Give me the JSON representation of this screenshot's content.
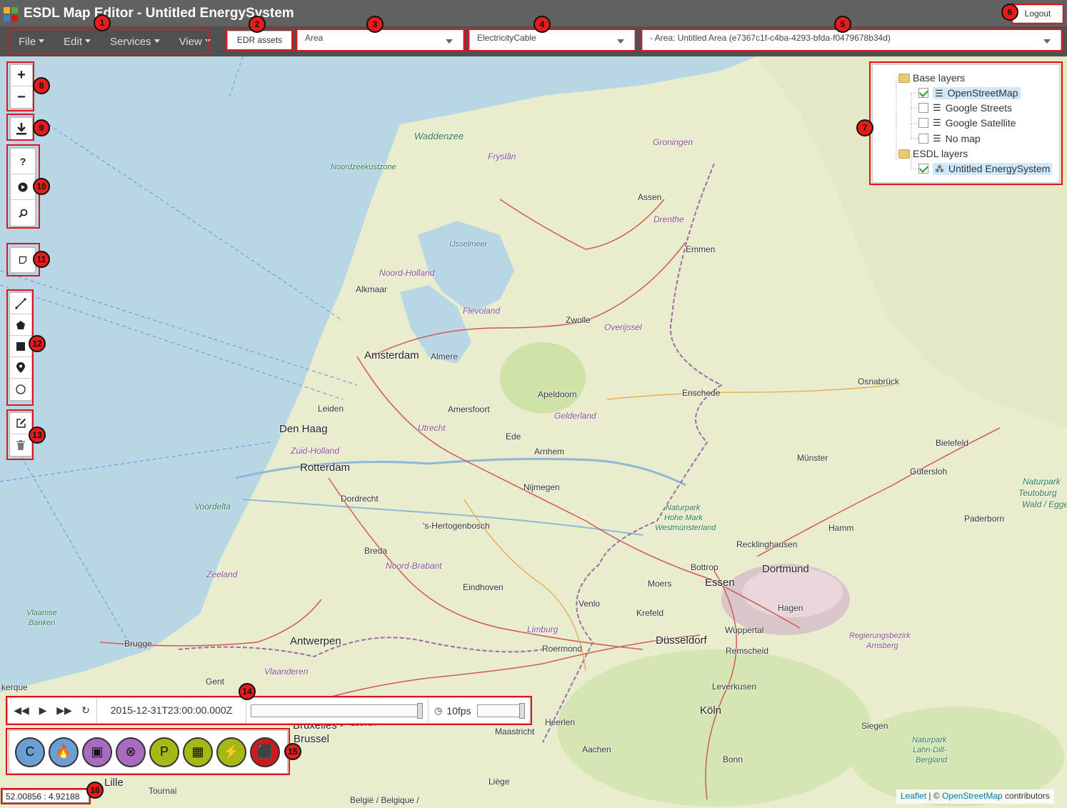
{
  "app": {
    "title": "ESDL Map Editor - Untitled EnergySystem"
  },
  "header": {
    "logout_label": "Logout"
  },
  "menubar": {
    "items": [
      {
        "label": "File"
      },
      {
        "label": "Edit"
      },
      {
        "label": "Services"
      },
      {
        "label": "View"
      }
    ]
  },
  "toolbar": {
    "edr_label": "EDR assets",
    "area_select": "Area",
    "asset_select": "ElectricityCable",
    "area_scope_select": "- Area: Untitled Area (e7367c1f-c4ba-4293-bfda-f0479678b34d)"
  },
  "layers": {
    "base_group": "Base layers",
    "base_items": [
      {
        "label": "OpenStreetMap",
        "checked": true
      },
      {
        "label": "Google Streets",
        "checked": false
      },
      {
        "label": "Google Satellite",
        "checked": false
      },
      {
        "label": "No map",
        "checked": false
      }
    ],
    "esdl_group": "ESDL layers",
    "esdl_items": [
      {
        "label": "Untitled EnergySystem",
        "checked": true
      }
    ]
  },
  "map_controls": {
    "zoom_in": "+",
    "zoom_out": "−",
    "help": "?"
  },
  "player": {
    "timestamp": "2015-12-31T23:00:00.000Z",
    "fps": "10fps"
  },
  "assets": [
    {
      "icon": "C",
      "color": "#4d8fc9",
      "name": "consumer-c"
    },
    {
      "icon": "🔥",
      "color": "#4d8fc9",
      "name": "flame"
    },
    {
      "icon": "▣",
      "color": "#9b59b6",
      "name": "storage"
    },
    {
      "icon": "⊗",
      "color": "#9b59b6",
      "name": "conversion"
    },
    {
      "icon": "P",
      "color": "#a6b814",
      "name": "producer-p"
    },
    {
      "icon": "▦",
      "color": "#a6b814",
      "name": "network"
    },
    {
      "icon": "⚡",
      "color": "#a6b814",
      "name": "plant"
    },
    {
      "icon": "⬛",
      "color": "#d0191b",
      "name": "battery"
    }
  ],
  "coords": "52.00856 : 4.92188",
  "attribution": {
    "leaflet": "Leaflet",
    "sep": " | © ",
    "osm": "OpenStreetMap",
    "tail": " contributors"
  },
  "places": {
    "waddenzee": "Waddenzee",
    "noordzeekustzone": "Noordzeekustzone",
    "fryslan": "Fryslân",
    "groningen": "Groningen",
    "assen": "Assen",
    "drenthe": "Drenthe",
    "emmen": "Emmen",
    "ijsselmeer": "IJsselmeer",
    "noordholland": "Noord-Holland",
    "alkmaar": "Alkmaar",
    "flevoland": "Flevoland",
    "zwolle": "Zwolle",
    "overijssel": "Overijssel",
    "amsterdam": "Amsterdam",
    "almere": "Almere",
    "apeldoorn": "Apeldoorn",
    "enschede": "Enschede",
    "osnabruck": "Osnabrück",
    "leiden": "Leiden",
    "amersfoort": "Amersfoort",
    "gelderland": "Gelderland",
    "denhaag": "Den Haag",
    "utrecht": "Utrecht",
    "ede": "Ede",
    "zuidholland": "Zuid-Holland",
    "arnhem": "Arnhem",
    "rotterdam": "Rotterdam",
    "munster": "Münster",
    "bielefeld": "Bielefeld",
    "gutersloh": "Gütersloh",
    "nijmegen": "Nijmegen",
    "dordrecht": "Dordrecht",
    "voordelta": "Voordelta",
    "naturpark1": "Naturpark",
    "hohemark": "Hohe Mark",
    "westmunsterland": "Westmünsterland",
    "paderborn": "Paderborn",
    "shertogenbosch": "'s-Hertogenbosch",
    "hamm": "Hamm",
    "recklinghausen": "Recklinghausen",
    "breda": "Breda",
    "bottrop": "Bottrop",
    "dortmund": "Dortmund",
    "noordbrabant": "Noord-Brabant",
    "zeeland": "Zeeland",
    "eindhoven": "Eindhoven",
    "moers": "Moers",
    "essen": "Essen",
    "hagen": "Hagen",
    "vlaamse": "Vlaamse",
    "banken": "Banken",
    "venlo": "Venlo",
    "krefeld": "Krefeld",
    "limburg": "Limburg",
    "wuppertal": "Wuppertal",
    "brugge": "Brugge",
    "roermond": "Roermond",
    "dusseldorf": "Düsseldorf",
    "remscheid": "Remscheid",
    "regierung": "Regierungsbezirk",
    "arnsberg": "Arnsberg",
    "antwerpen": "Antwerpen",
    "vlaanderen": "Vlaanderen",
    "gent": "Gent",
    "leverkusen": "Leverkusen",
    "koln": "Köln",
    "siegen": "Siegen",
    "bruxelles": "Bruxelles -",
    "brussel": "Brussel",
    "leuven": "Leuven",
    "maastricht": "Maastricht",
    "heerlen": "Heerlen",
    "aachen": "Aachen",
    "bonn": "Bonn",
    "lille": "Lille",
    "tournai": "Tournai",
    "liege": "Liège",
    "naturpark2": "Naturpark",
    "lahndill": "Lahn-Dill-",
    "bergland": "Bergland",
    "belgique": "België / Belgique /",
    "teutoburg1": "Naturpark",
    "teutoburg2": "Teutoburg",
    "teutoburg3": "Wald / Egge",
    "kerque": "kerque"
  },
  "callouts": [
    "1",
    "2",
    "3",
    "4",
    "5",
    "6",
    "7",
    "8",
    "9",
    "10",
    "11",
    "12",
    "13",
    "14",
    "15",
    "16"
  ]
}
